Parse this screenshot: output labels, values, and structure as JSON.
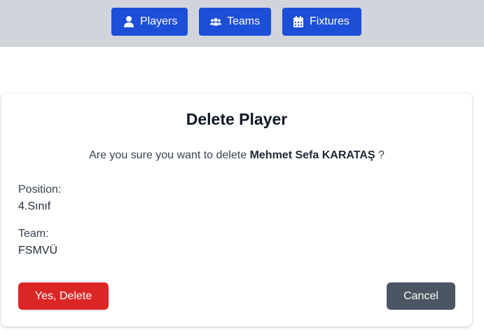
{
  "nav": {
    "items": [
      {
        "label": "Players",
        "icon": "user-icon"
      },
      {
        "label": "Teams",
        "icon": "users-icon"
      },
      {
        "label": "Fixtures",
        "icon": "calendar-icon"
      }
    ]
  },
  "modal": {
    "title": "Delete Player",
    "question_prefix": "Are you sure you want to delete",
    "player_name": "Mehmet Sefa KARATAŞ",
    "question_suffix": "?",
    "position_label": "Position:",
    "position_value": "4.Sınıf",
    "team_label": "Team:",
    "team_value": "FSMVÜ",
    "confirm_label": "Yes, Delete",
    "cancel_label": "Cancel"
  },
  "colors": {
    "nav_bg": "#d1d5db",
    "nav_button": "#1d4ed8",
    "danger": "#dc2626",
    "secondary": "#4b5563"
  }
}
